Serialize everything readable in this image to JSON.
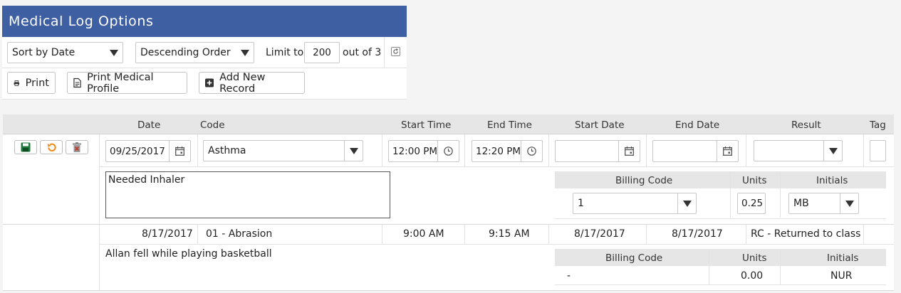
{
  "panel": {
    "title": "Medical Log Options",
    "sort_select": "Sort by Date",
    "order_select": "Descending Order",
    "limit_label": "Limit to",
    "limit_value": "200",
    "out_of_label": "out of 3",
    "buttons": {
      "print": "Print",
      "print_profile": "Print Medical Profile",
      "add_record": "Add New Record"
    }
  },
  "grid": {
    "headers": {
      "date": "Date",
      "code": "Code",
      "start_time": "Start Time",
      "end_time": "End Time",
      "start_date": "Start Date",
      "end_date": "End Date",
      "result": "Result",
      "tag": "Tag"
    },
    "edit_row": {
      "date": "09/25/2017",
      "code": "Asthma",
      "start_time": "12:00 PM",
      "end_time": "12:20 PM",
      "start_date": "",
      "end_date": "",
      "result": "",
      "notes": "Needed Inhaler",
      "billing": {
        "headers": {
          "billing_code": "Billing Code",
          "units": "Units",
          "initials": "Initials"
        },
        "billing_code": "1",
        "units": "0.25",
        "initials": "MB"
      }
    },
    "rows": [
      {
        "date": "8/17/2017",
        "code": "01 - Abrasion",
        "start_time": "9:00 AM",
        "end_time": "9:15 AM",
        "start_date": "8/17/2017",
        "end_date": "8/17/2017",
        "result": "RC - Returned to class",
        "notes": "Allan fell while playing basketball",
        "billing": {
          "headers": {
            "billing_code": "Billing Code",
            "units": "Units",
            "initials": "Initials"
          },
          "billing_code": "-",
          "units": "0.00",
          "initials": "NUR"
        }
      }
    ]
  },
  "colors": {
    "title_bar": "#3f5fa3",
    "save_icon": "#1d7a3a",
    "undo_icon": "#f08a1c",
    "delete_icon": "#c0392b"
  }
}
